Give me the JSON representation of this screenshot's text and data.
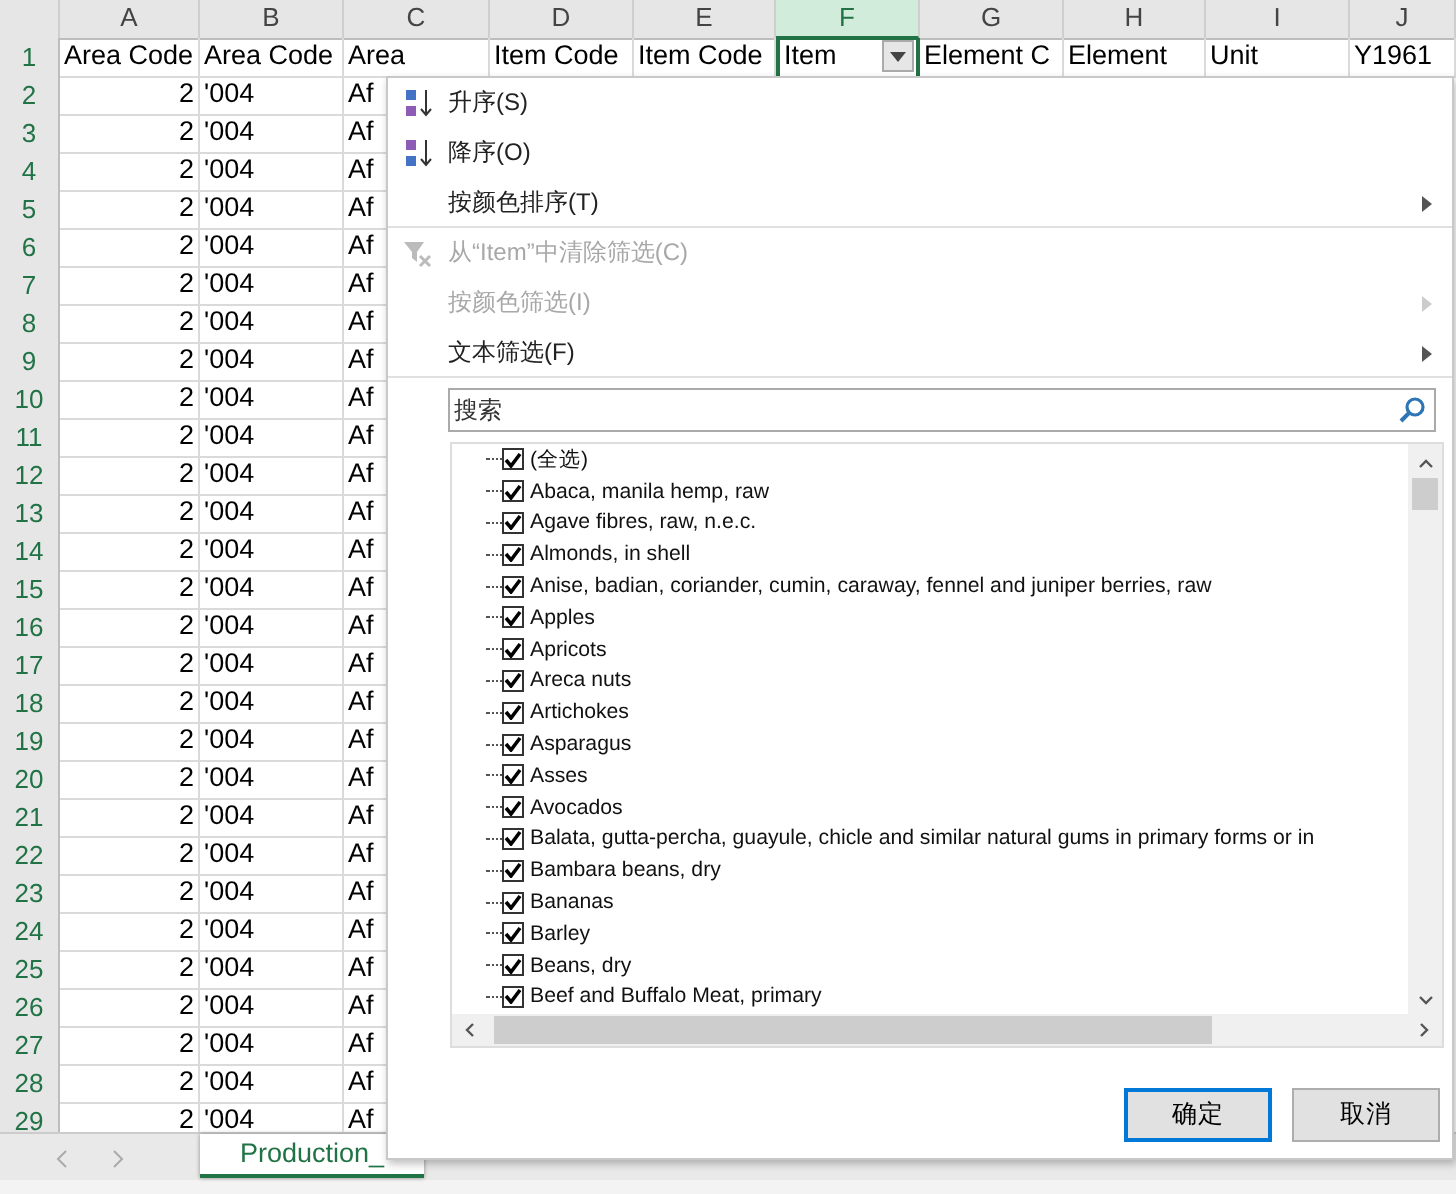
{
  "columns": [
    {
      "label": "A",
      "selected": false,
      "filter_button": false
    },
    {
      "label": "B",
      "selected": false,
      "filter_button": false
    },
    {
      "label": "C",
      "selected": false,
      "filter_button": false
    },
    {
      "label": "D",
      "selected": false,
      "filter_button": false
    },
    {
      "label": "E",
      "selected": false,
      "filter_button": false
    },
    {
      "label": "F",
      "selected": true,
      "filter_button": true
    },
    {
      "label": "G",
      "selected": false,
      "filter_button": false
    },
    {
      "label": "H",
      "selected": false,
      "filter_button": false
    },
    {
      "label": "I",
      "selected": false,
      "filter_button": false
    },
    {
      "label": "J",
      "selected": false,
      "filter_button": false
    }
  ],
  "header_row": {
    "number": "1",
    "cells": [
      "Area Code",
      "Area Code",
      "Area",
      "Item Code",
      "Item Code",
      "Item",
      "Element C",
      "Element",
      "Unit",
      "Y1961"
    ]
  },
  "rows": [
    {
      "number": "2",
      "cells": [
        "2",
        "'004",
        "Af"
      ]
    },
    {
      "number": "3",
      "cells": [
        "2",
        "'004",
        "Af"
      ]
    },
    {
      "number": "4",
      "cells": [
        "2",
        "'004",
        "Af"
      ]
    },
    {
      "number": "5",
      "cells": [
        "2",
        "'004",
        "Af"
      ]
    },
    {
      "number": "6",
      "cells": [
        "2",
        "'004",
        "Af"
      ]
    },
    {
      "number": "7",
      "cells": [
        "2",
        "'004",
        "Af"
      ]
    },
    {
      "number": "8",
      "cells": [
        "2",
        "'004",
        "Af"
      ]
    },
    {
      "number": "9",
      "cells": [
        "2",
        "'004",
        "Af"
      ]
    },
    {
      "number": "10",
      "cells": [
        "2",
        "'004",
        "Af"
      ]
    },
    {
      "number": "11",
      "cells": [
        "2",
        "'004",
        "Af"
      ]
    },
    {
      "number": "12",
      "cells": [
        "2",
        "'004",
        "Af"
      ]
    },
    {
      "number": "13",
      "cells": [
        "2",
        "'004",
        "Af"
      ]
    },
    {
      "number": "14",
      "cells": [
        "2",
        "'004",
        "Af"
      ]
    },
    {
      "number": "15",
      "cells": [
        "2",
        "'004",
        "Af"
      ]
    },
    {
      "number": "16",
      "cells": [
        "2",
        "'004",
        "Af"
      ]
    },
    {
      "number": "17",
      "cells": [
        "2",
        "'004",
        "Af"
      ]
    },
    {
      "number": "18",
      "cells": [
        "2",
        "'004",
        "Af"
      ]
    },
    {
      "number": "19",
      "cells": [
        "2",
        "'004",
        "Af"
      ]
    },
    {
      "number": "20",
      "cells": [
        "2",
        "'004",
        "Af"
      ]
    },
    {
      "number": "21",
      "cells": [
        "2",
        "'004",
        "Af"
      ]
    },
    {
      "number": "22",
      "cells": [
        "2",
        "'004",
        "Af"
      ]
    },
    {
      "number": "23",
      "cells": [
        "2",
        "'004",
        "Af"
      ]
    },
    {
      "number": "24",
      "cells": [
        "2",
        "'004",
        "Af"
      ]
    },
    {
      "number": "25",
      "cells": [
        "2",
        "'004",
        "Af"
      ]
    },
    {
      "number": "26",
      "cells": [
        "2",
        "'004",
        "Af"
      ]
    },
    {
      "number": "27",
      "cells": [
        "2",
        "'004",
        "Af"
      ]
    },
    {
      "number": "28",
      "cells": [
        "2",
        "'004",
        "Af"
      ]
    },
    {
      "number": "29",
      "cells": [
        "2",
        "'004",
        "Af"
      ]
    }
  ],
  "sheet_tabs": [
    {
      "label": "Production_",
      "selected": true
    }
  ],
  "filter_menu": {
    "items": [
      {
        "kind": "sort-asc",
        "label": "升序(S)",
        "disabled": false,
        "submenu": false
      },
      {
        "kind": "sort-desc",
        "label": "降序(O)",
        "disabled": false,
        "submenu": false
      },
      {
        "kind": "plain",
        "label": "按颜色排序(T)",
        "disabled": false,
        "submenu": true,
        "separator_after": true
      },
      {
        "kind": "clear-filter",
        "label": "从“Item”中清除筛选(C)",
        "disabled": true,
        "submenu": false
      },
      {
        "kind": "plain",
        "label": "按颜色筛选(I)",
        "disabled": true,
        "submenu": true
      },
      {
        "kind": "plain",
        "label": "文本筛选(F)",
        "disabled": false,
        "submenu": true,
        "separator_after": true
      }
    ],
    "search": {
      "placeholder": "搜索"
    },
    "values": [
      {
        "label": "(全选)",
        "checked": true
      },
      {
        "label": "Abaca, manila hemp, raw",
        "checked": true
      },
      {
        "label": "Agave fibres, raw, n.e.c.",
        "checked": true
      },
      {
        "label": "Almonds, in shell",
        "checked": true
      },
      {
        "label": "Anise, badian, coriander, cumin, caraway, fennel and juniper berries, raw",
        "checked": true
      },
      {
        "label": "Apples",
        "checked": true
      },
      {
        "label": "Apricots",
        "checked": true
      },
      {
        "label": "Areca nuts",
        "checked": true
      },
      {
        "label": "Artichokes",
        "checked": true
      },
      {
        "label": "Asparagus",
        "checked": true
      },
      {
        "label": "Asses",
        "checked": true
      },
      {
        "label": "Avocados",
        "checked": true
      },
      {
        "label": "Balata, gutta-percha, guayule, chicle and similar natural gums in primary forms or in",
        "checked": true
      },
      {
        "label": "Bambara beans, dry",
        "checked": true
      },
      {
        "label": "Bananas",
        "checked": true
      },
      {
        "label": "Barley",
        "checked": true
      },
      {
        "label": "Beans, dry",
        "checked": true
      },
      {
        "label": "Beef and Buffalo Meat, primary",
        "checked": true
      }
    ],
    "buttons": [
      {
        "label": "确定",
        "default": true
      },
      {
        "label": "取消",
        "default": false
      }
    ]
  }
}
